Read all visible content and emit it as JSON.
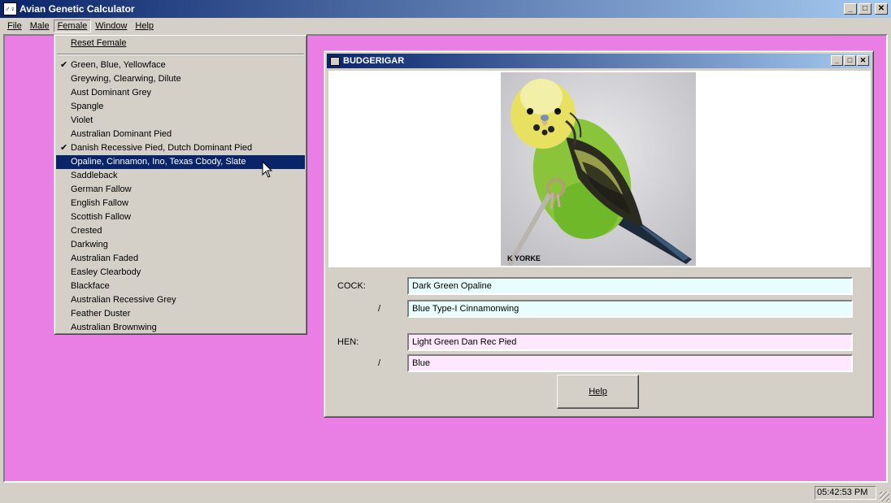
{
  "app": {
    "title": "Avian Genetic Calculator",
    "icon_glyph": "♂♀"
  },
  "menubar": {
    "items": [
      {
        "label": "File"
      },
      {
        "label": "Male"
      },
      {
        "label": "Female"
      },
      {
        "label": "Window"
      },
      {
        "label": "Help"
      }
    ]
  },
  "female_menu": {
    "reset_label": "Reset Female",
    "items": [
      {
        "label": "Green, Blue, Yellowface",
        "checked": true
      },
      {
        "label": "Greywing, Clearwing, Dilute"
      },
      {
        "label": "Aust Dominant Grey"
      },
      {
        "label": "Spangle"
      },
      {
        "label": "Violet"
      },
      {
        "label": "Australian Dominant Pied"
      },
      {
        "label": "Danish Recessive Pied, Dutch Dominant Pied",
        "checked": true
      },
      {
        "label": "Opaline, Cinnamon, Ino, Texas Cbody, Slate",
        "selected": true
      },
      {
        "label": "Saddleback"
      },
      {
        "label": "German Fallow"
      },
      {
        "label": "English Fallow"
      },
      {
        "label": "Scottish Fallow"
      },
      {
        "label": "Crested"
      },
      {
        "label": "Darkwing"
      },
      {
        "label": "Australian Faded"
      },
      {
        "label": "Easley Clearbody"
      },
      {
        "label": "Blackface"
      },
      {
        "label": "Australian Recessive Grey"
      },
      {
        "label": "Feather Duster"
      },
      {
        "label": "Australian Brownwing"
      }
    ]
  },
  "budgerigar": {
    "title": "BUDGERIGAR",
    "photo_credit": "K YORKE",
    "cock_label": "COCK:",
    "hen_label": "HEN:",
    "slash": "/",
    "cock_value": "Dark Green Opaline",
    "cock_split": "Blue Type-I Cinnamonwing",
    "hen_value": "Light Green Dan Rec Pied",
    "hen_split": "Blue",
    "help_label": "Help"
  },
  "status": {
    "clock": "05:42:53 PM"
  },
  "colors": {
    "client_bg": "#e97ee5",
    "title_active": "#0a246a",
    "cock_field": "#e8fefe",
    "hen_field": "#fde8fd",
    "menu_highlight": "#0a246a"
  }
}
